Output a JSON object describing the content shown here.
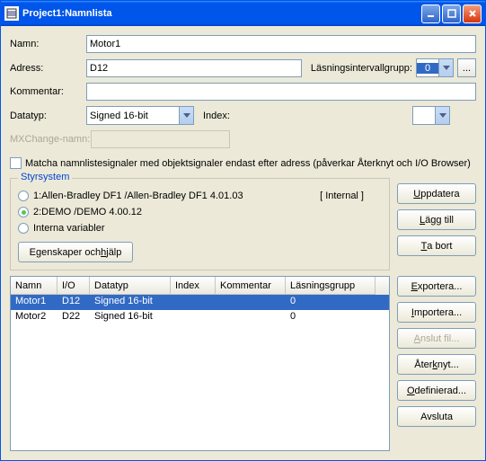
{
  "window": {
    "title": "Project1:Namnlista"
  },
  "labels": {
    "namn": "Namn:",
    "adress": "Adress:",
    "kommentar": "Kommentar:",
    "datatyp": "Datatyp:",
    "index": "Index:",
    "mxchange": "MXChange-namn:",
    "lasning": "Läsningsintervallgrupp:",
    "match": "Matcha namnlistesignaler med objektsignaler endast efter adress (påverkar Återknyt och I/O Browser)",
    "styrsystem": "Styrsystem",
    "internal": "[ Internal ]"
  },
  "fields": {
    "namn": "Motor1",
    "adress": "D12",
    "kommentar": "",
    "datatyp": "Signed 16-bit",
    "index": "",
    "lasning": "0"
  },
  "radios": {
    "opt1": "1:Allen-Bradley DF1 /Allen-Bradley DF1  4.01.03",
    "opt2": "2:DEMO /DEMO  4.00.12",
    "opt3": "Interna variabler"
  },
  "buttons": {
    "egenskaper_pre": "Egenskaper och ",
    "egenskaper_u": "h",
    "egenskaper_post": "jälp",
    "uppdatera_u": "U",
    "uppdatera_post": "ppdatera",
    "laggtill_u": "L",
    "laggtill_post": "ägg till",
    "tabort_u": "T",
    "tabort_post": "a bort",
    "exportera_u": "E",
    "exportera_post": "xportera...",
    "importera_u": "I",
    "importera_post": "mportera...",
    "anslutfil_u": "A",
    "anslutfil_post": "nslut fil...",
    "aterknyt_pre": "Åter",
    "aterknyt_u": "k",
    "aterknyt_post": "nyt...",
    "odef_pre": "",
    "odef_u": "O",
    "odef_post": "definierad...",
    "avsluta": "Avsluta",
    "ellipsis": "..."
  },
  "columns": {
    "namn": "Namn",
    "io": "I/O",
    "datatyp": "Datatyp",
    "index": "Index",
    "kommentar": "Kommentar",
    "lasning": "Läsningsgrupp"
  },
  "rows": [
    {
      "namn": "Motor1",
      "io": "D12",
      "datatyp": "Signed 16-bit",
      "index": "",
      "kommentar": "",
      "lasning": "0",
      "selected": true
    },
    {
      "namn": "Motor2",
      "io": "D22",
      "datatyp": "Signed 16-bit",
      "index": "",
      "kommentar": "",
      "lasning": "0",
      "selected": false
    }
  ],
  "colwidths": {
    "namn": 52,
    "io": 36,
    "datatyp": 90,
    "index": 50,
    "kommentar": 78,
    "lasning": 100
  }
}
